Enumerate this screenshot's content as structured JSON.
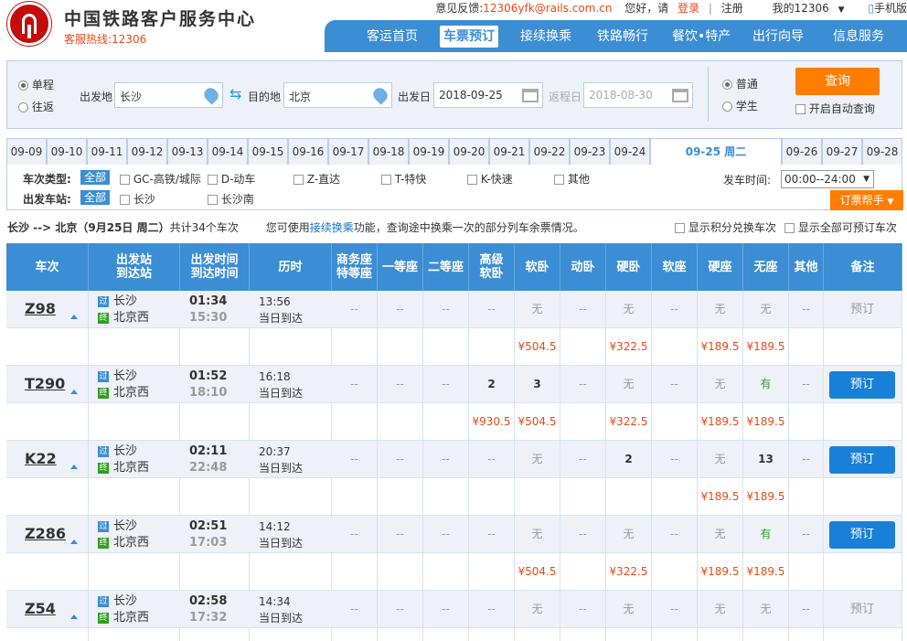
{
  "header": {
    "site_title": "中国铁路客户服务中心",
    "hotline": "客服热线:12306",
    "feedback_label": "意见反馈:",
    "feedback_email": "12306yfk@rails.com.cn",
    "greeting": "您好，请",
    "login": "登录",
    "divider": "|",
    "register": "注册",
    "my12306": "我的12306",
    "mobile": "手机版"
  },
  "nav": {
    "items": [
      "客运首页",
      "车票预订",
      "接续换乘",
      "铁路畅行",
      "餐饮•特产",
      "出行向导",
      "信息服务"
    ]
  },
  "search": {
    "trip_single": "单程",
    "trip_round": "往返",
    "from_label": "出发地",
    "from_value": "长沙",
    "to_label": "目的地",
    "to_value": "北京",
    "depart_label": "出发日",
    "depart_value": "2018-09-25",
    "return_label": "返程日",
    "return_value": "2018-08-30",
    "ticket_normal": "普通",
    "ticket_student": "学生",
    "query_btn": "查询",
    "auto_query": "开启自动查询"
  },
  "dates": [
    "09-09",
    "09-10",
    "09-11",
    "09-12",
    "09-13",
    "09-14",
    "09-15",
    "09-16",
    "09-17",
    "09-18",
    "09-19",
    "09-20",
    "09-21",
    "09-22",
    "09-23",
    "09-24",
    "09-25 周二",
    "09-26",
    "09-27",
    "09-28"
  ],
  "filters": {
    "type_label": "车次类型:",
    "station_label": "出发车站:",
    "all": "全部",
    "types": [
      "GC-高铁/城际",
      "D-动车",
      "Z-直达",
      "T-特快",
      "K-快速",
      "其他"
    ],
    "stations": [
      "长沙",
      "长沙南"
    ],
    "time_label": "发车时间:",
    "time_value": "00:00--24:00",
    "help_btn": "订票帮手"
  },
  "summary": {
    "route": "长沙 --> 北京（9月25日  周二）",
    "count": "共计34个车次",
    "tip_pre": "您可使用",
    "tip_link": "接续换乘",
    "tip_post": "功能，查询途中换乘一次的部分列车余票情况。",
    "opt1": "显示积分兑换车次",
    "opt2": "显示全部可预订车次"
  },
  "table_headers": [
    "车次",
    "出发站\n到达站",
    "出发时间\n到达时间",
    "历时",
    "商务座\n特等座",
    "一等座",
    "二等座",
    "高级\n软卧",
    "软卧",
    "动卧",
    "硬卧",
    "软座",
    "硬座",
    "无座",
    "其他",
    "备注"
  ],
  "trains": [
    {
      "no": "Z98",
      "from": "长沙",
      "to": "北京西",
      "dep": "01:34",
      "arr": "15:30",
      "dur": "13:56",
      "arrive_note": "当日到达",
      "seats": [
        "--",
        "--",
        "--",
        "--",
        "无",
        "--",
        "无",
        "--",
        "无",
        "无",
        "--"
      ],
      "prices": [
        "",
        "",
        "",
        "",
        "¥504.5",
        "",
        "¥322.5",
        "",
        "¥189.5",
        "¥189.5",
        ""
      ],
      "book": "预订",
      "bookable": false
    },
    {
      "no": "T290",
      "from": "长沙",
      "to": "北京西",
      "dep": "01:52",
      "arr": "18:10",
      "dur": "16:18",
      "arrive_note": "当日到达",
      "seats": [
        "--",
        "--",
        "--",
        "2",
        "3",
        "--",
        "无",
        "--",
        "无",
        "有",
        "--"
      ],
      "prices": [
        "",
        "",
        "",
        "¥930.5",
        "¥504.5",
        "",
        "¥322.5",
        "",
        "¥189.5",
        "¥189.5",
        ""
      ],
      "book": "预订",
      "bookable": true
    },
    {
      "no": "K22",
      "from": "长沙",
      "to": "北京西",
      "dep": "02:11",
      "arr": "22:48",
      "dur": "20:37",
      "arrive_note": "当日到达",
      "seats": [
        "--",
        "--",
        "--",
        "--",
        "无",
        "--",
        "2",
        "--",
        "无",
        "13",
        "--"
      ],
      "prices": [
        "",
        "",
        "",
        "",
        "",
        "",
        "",
        "",
        "¥189.5",
        "¥189.5",
        ""
      ],
      "book": "预订",
      "bookable": true
    },
    {
      "no": "Z286",
      "from": "长沙",
      "to": "北京西",
      "dep": "02:51",
      "arr": "17:03",
      "dur": "14:12",
      "arrive_note": "当日到达",
      "seats": [
        "--",
        "--",
        "--",
        "--",
        "无",
        "--",
        "无",
        "--",
        "无",
        "有",
        "--"
      ],
      "prices": [
        "",
        "",
        "",
        "",
        "¥504.5",
        "",
        "¥322.5",
        "",
        "¥189.5",
        "¥189.5",
        ""
      ],
      "book": "预订",
      "bookable": true
    },
    {
      "no": "Z54",
      "from": "长沙",
      "to": "北京西",
      "dep": "02:58",
      "arr": "17:32",
      "dur": "14:34",
      "arrive_note": "当日到达",
      "seats": [
        "--",
        "--",
        "--",
        "--",
        "无",
        "--",
        "无",
        "--",
        "无",
        "无",
        "--"
      ],
      "prices": [
        "",
        "",
        "",
        "",
        "",
        "",
        "",
        "",
        "",
        "",
        ""
      ],
      "book": "预订",
      "bookable": false
    }
  ],
  "colors": {
    "primary": "#3b8dd4",
    "accent": "#ff7d00",
    "price": "#e64a19",
    "available": "#2e9f1f"
  }
}
